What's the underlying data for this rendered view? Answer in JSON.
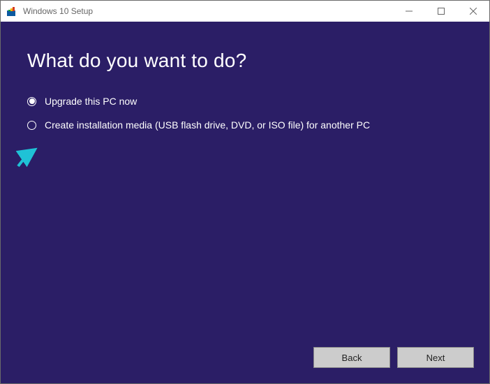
{
  "titlebar": {
    "title": "Windows 10 Setup"
  },
  "page": {
    "heading": "What do you want to do?"
  },
  "options": [
    {
      "label": "Upgrade this PC now",
      "selected": true
    },
    {
      "label": "Create installation media (USB flash drive, DVD, or ISO file) for another PC",
      "selected": false
    }
  ],
  "buttons": {
    "back": "Back",
    "next": "Next"
  }
}
